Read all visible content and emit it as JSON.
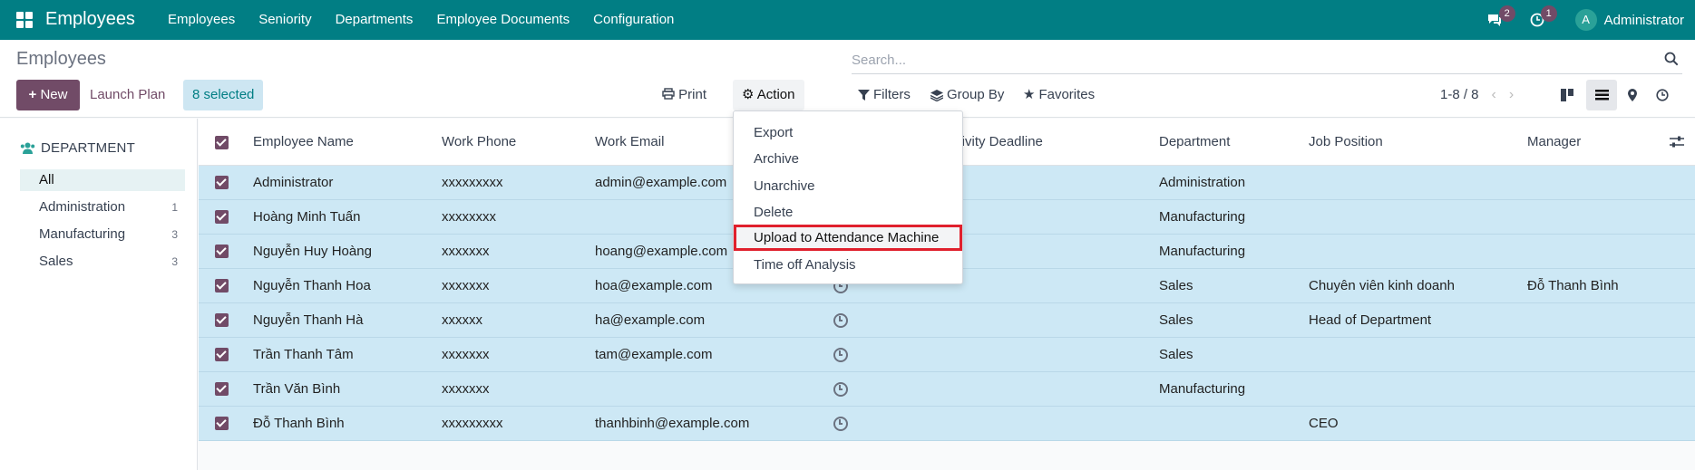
{
  "navbar": {
    "app_name": "Employees",
    "menu": [
      "Employees",
      "Seniority",
      "Departments",
      "Employee Documents",
      "Configuration"
    ],
    "messages_count": "2",
    "activities_count": "1",
    "avatar_letter": "A",
    "user": "Administrator"
  },
  "control": {
    "breadcrumb": "Employees",
    "new_label": "New",
    "launch_plan": "Launch Plan",
    "selected": "8 selected",
    "print": "Print",
    "action": "Action",
    "search_placeholder": "Search...",
    "filters": "Filters",
    "group_by": "Group By",
    "favorites": "Favorites",
    "pager": "1-8 / 8"
  },
  "sidebar": {
    "header": "DEPARTMENT",
    "items": [
      {
        "label": "All",
        "count": ""
      },
      {
        "label": "Administration",
        "count": "1"
      },
      {
        "label": "Manufacturing",
        "count": "3"
      },
      {
        "label": "Sales",
        "count": "3"
      }
    ]
  },
  "table": {
    "headers": [
      "Employee Name",
      "Work Phone",
      "Work Email",
      "ctivity Deadline",
      "Department",
      "Job Position",
      "Manager"
    ],
    "rows": [
      {
        "name": "Administrator",
        "phone": "xxxxxxxxx",
        "email": "admin@example.com",
        "department": "Administration",
        "job": "",
        "manager": ""
      },
      {
        "name": "Hoàng Minh Tuấn",
        "phone": "xxxxxxxx",
        "email": "",
        "department": "Manufacturing",
        "job": "",
        "manager": ""
      },
      {
        "name": "Nguyễn Huy Hoàng",
        "phone": "xxxxxxx",
        "email": "hoang@example.com",
        "department": "Manufacturing",
        "job": "",
        "manager": ""
      },
      {
        "name": "Nguyễn Thanh Hoa",
        "phone": "xxxxxxx",
        "email": "hoa@example.com",
        "department": "Sales",
        "job": "Chuyên viên kinh doanh",
        "manager": "Đỗ Thanh Bình"
      },
      {
        "name": "Nguyễn Thanh Hà",
        "phone": "xxxxxx",
        "email": "ha@example.com",
        "department": "Sales",
        "job": "Head of Department",
        "manager": ""
      },
      {
        "name": "Trần Thanh Tâm",
        "phone": "xxxxxxx",
        "email": "tam@example.com",
        "department": "Sales",
        "job": "",
        "manager": ""
      },
      {
        "name": "Trần Văn Bình",
        "phone": "xxxxxxx",
        "email": "",
        "department": "Manufacturing",
        "job": "",
        "manager": ""
      },
      {
        "name": "Đỗ Thanh Bình",
        "phone": "xxxxxxxxx",
        "email": "thanhbinh@example.com",
        "department": "",
        "job": "CEO",
        "manager": ""
      }
    ]
  },
  "action_menu": {
    "items": [
      "Export",
      "Archive",
      "Unarchive",
      "Delete",
      "Upload to Attendance Machine",
      "Time off Analysis"
    ],
    "highlighted": "Upload to Attendance Machine"
  },
  "colors": {
    "navbar": "#017e84",
    "primary": "#714b67",
    "selected_row": "#cde8f5",
    "highlight_border": "#e0202d"
  }
}
